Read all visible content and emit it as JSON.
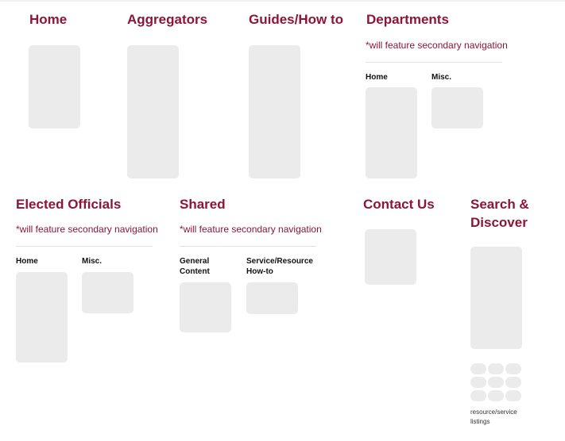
{
  "colors": {
    "accent": "#8c1538",
    "box": "#ebebeb",
    "divider": "#e2e2e2",
    "label": "#111111"
  },
  "columns": {
    "home": {
      "title": "Home"
    },
    "aggregators": {
      "title": "Aggregators"
    },
    "guides": {
      "title": "Guides/How to"
    },
    "departments": {
      "title": "Departments",
      "note": "*will feature secondary navigation",
      "subs": [
        "Home",
        "Misc."
      ]
    },
    "elected_officials": {
      "title": "Elected Officials",
      "note": "*will feature secondary navigation",
      "subs": [
        "Home",
        "Misc."
      ]
    },
    "shared": {
      "title": "Shared",
      "note": "*will feature secondary navigation",
      "subs": [
        "General\nContent",
        "Service/Resource\nHow-to"
      ]
    },
    "contact_us": {
      "title": "Contact Us"
    },
    "search_discover": {
      "title": "Search &\nDiscover",
      "caption": "resource/service\nlistings",
      "listing_pills": 9
    }
  }
}
